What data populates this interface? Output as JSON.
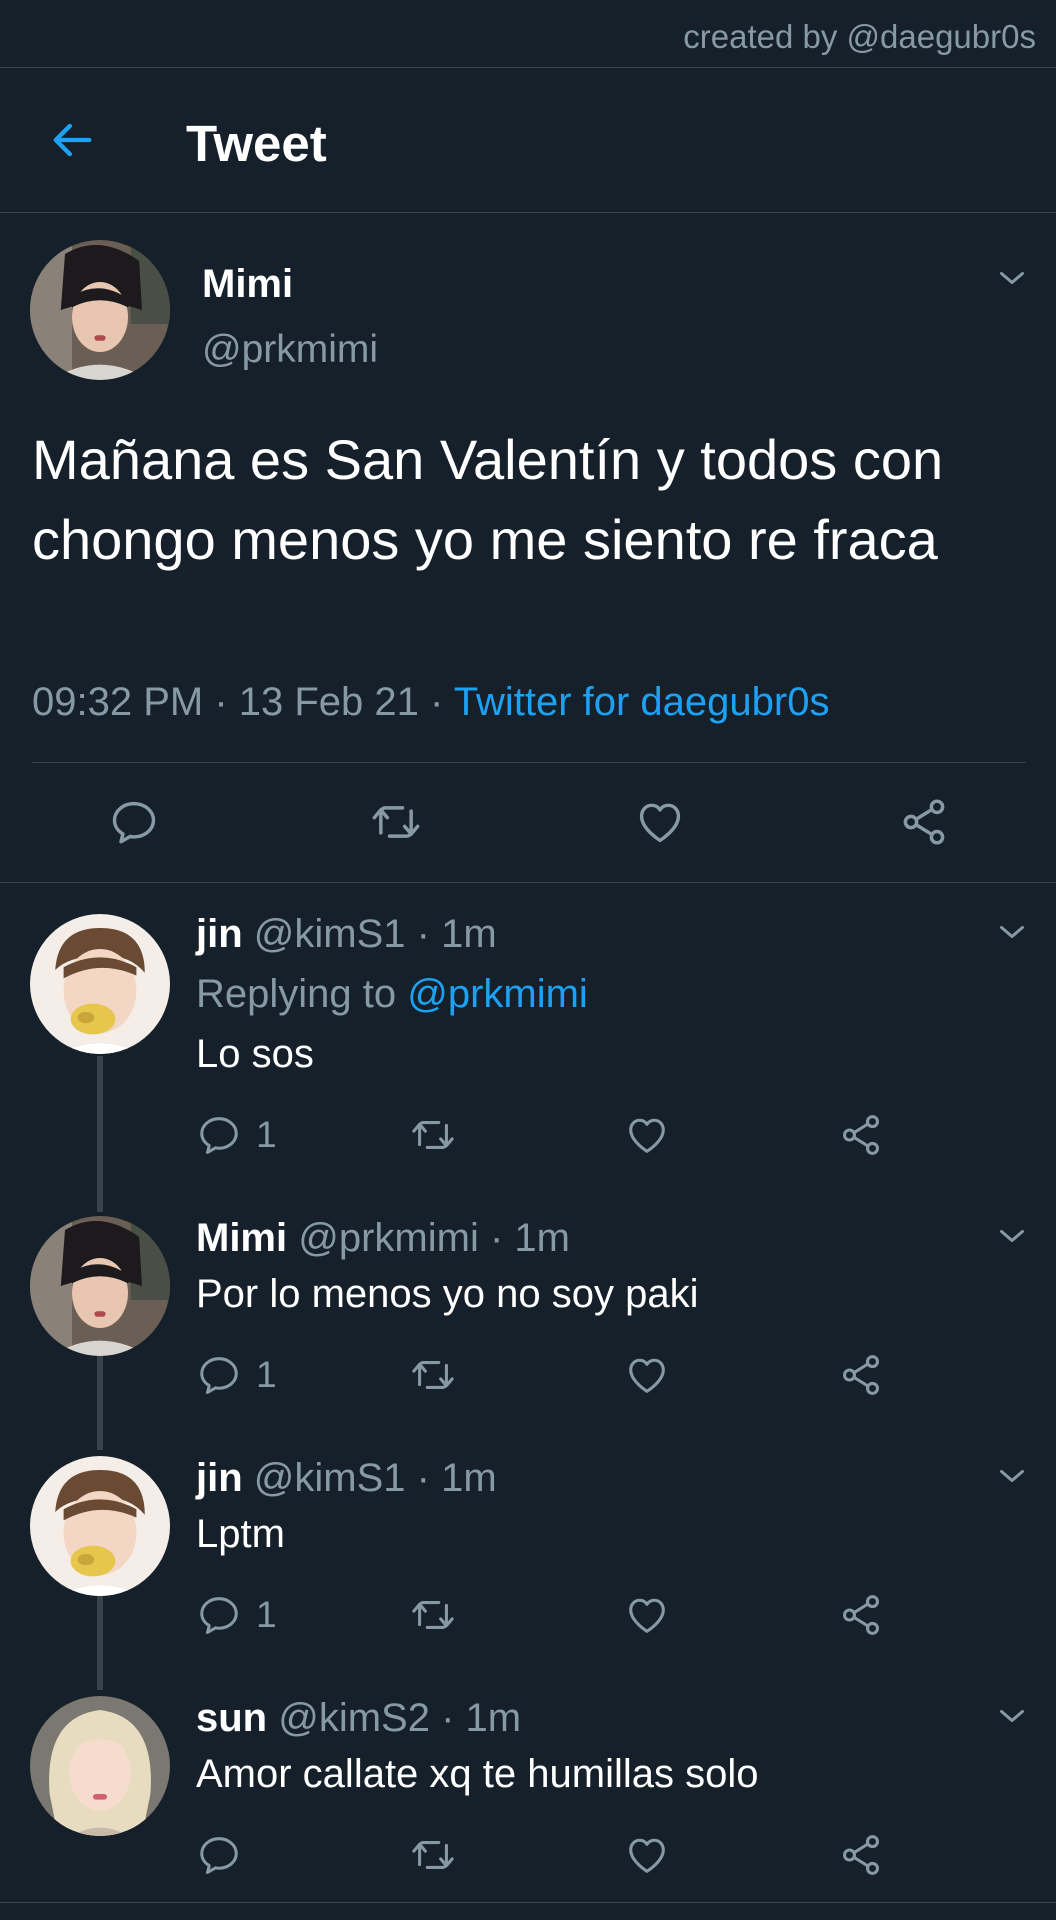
{
  "credit": "created by @daegubr0s",
  "header": {
    "title": "Tweet",
    "back_icon": "arrow-left-icon"
  },
  "colors": {
    "background": "#15202b",
    "accent": "#1da1f2",
    "muted": "#8899a6",
    "border": "#38444d"
  },
  "main_tweet": {
    "name": "Mimi",
    "handle": "@prkmimi",
    "text": "Mañana es San Valentín y todos con chongo menos yo me siento re fraca",
    "time": "09:32 PM · 13 Feb 21 · ",
    "source": "Twitter for daegubr0s"
  },
  "replies": [
    {
      "name": "jin",
      "meta": " @kimS1 · 1m",
      "replying_prefix": "Replying to ",
      "replying_to": "@prkmimi",
      "text": "Lo sos",
      "reply_count": "1"
    },
    {
      "name": "Mimi",
      "meta": " @prkmimi · 1m",
      "text": "Por lo menos yo no soy paki",
      "reply_count": "1"
    },
    {
      "name": "jin",
      "meta": " @kimS1 · 1m",
      "text": "Lptm",
      "reply_count": "1"
    },
    {
      "name": "sun",
      "meta": " @kimS2 · 1m",
      "text": "Amor callate xq te humillas solo",
      "reply_count": ""
    }
  ]
}
